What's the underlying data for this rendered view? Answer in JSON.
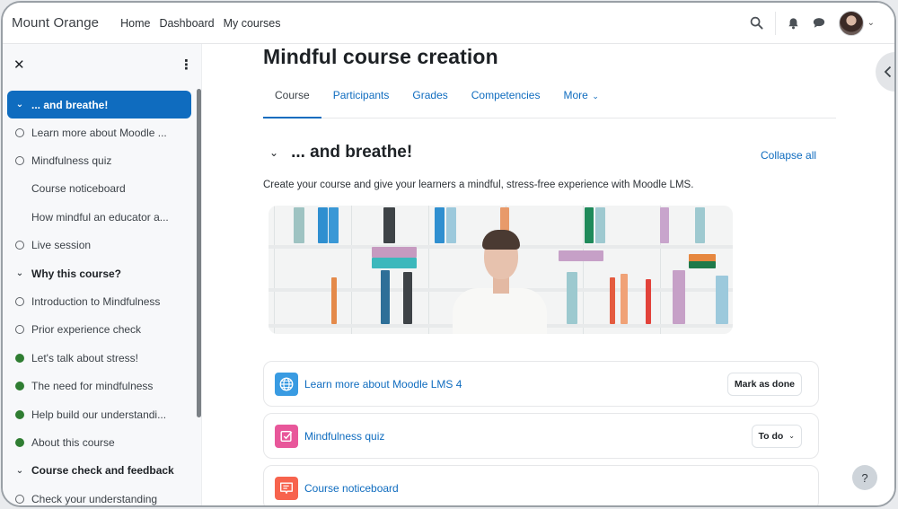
{
  "navbar": {
    "brand": "Mount Orange",
    "links": [
      "Home",
      "Dashboard",
      "My courses"
    ],
    "icons": [
      "search-icon",
      "bell-icon",
      "chat-icon"
    ],
    "user_menu_caret": "⌄"
  },
  "drawer": {
    "close_icon": "✕",
    "menu_icon": "⋮",
    "items": [
      {
        "label": "... and breathe!",
        "type": "section",
        "active": true
      },
      {
        "label": "Learn more about Moodle ...",
        "type": "activity",
        "status": "open"
      },
      {
        "label": "Mindfulness quiz",
        "type": "activity",
        "status": "open"
      },
      {
        "label": "Course noticeboard",
        "type": "activity",
        "status": "none"
      },
      {
        "label": "How mindful an educator a...",
        "type": "activity",
        "status": "none"
      },
      {
        "label": "Live session",
        "type": "activity",
        "status": "open"
      },
      {
        "label": "Why this course?",
        "type": "section",
        "active": false
      },
      {
        "label": "Introduction to Mindfulness",
        "type": "activity",
        "status": "open"
      },
      {
        "label": "Prior experience check",
        "type": "activity",
        "status": "open"
      },
      {
        "label": "Let's talk about stress!",
        "type": "activity",
        "status": "done"
      },
      {
        "label": "The need for mindfulness",
        "type": "activity",
        "status": "done"
      },
      {
        "label": "Help build our understandi...",
        "type": "activity",
        "status": "done"
      },
      {
        "label": "About this course",
        "type": "activity",
        "status": "done"
      },
      {
        "label": "Course check and feedback",
        "type": "section",
        "active": false
      },
      {
        "label": "Check your understanding",
        "type": "activity",
        "status": "open"
      }
    ]
  },
  "main": {
    "title": "Mindful course creation",
    "tabs": [
      {
        "label": "Course",
        "active": true
      },
      {
        "label": "Participants",
        "active": false
      },
      {
        "label": "Grades",
        "active": false
      },
      {
        "label": "Competencies",
        "active": false
      },
      {
        "label": "More",
        "active": false
      }
    ],
    "section": {
      "title": "... and breathe!",
      "collapse_all": "Collapse all",
      "summary": "Create your course and give your learners a mindful, stress-free experience with Moodle LMS."
    },
    "activities": [
      {
        "name": "Learn more about Moodle LMS 4",
        "icon": "globe-icon",
        "icon_color": "#399be2",
        "button": "Mark as done"
      },
      {
        "name": "Mindfulness quiz",
        "icon": "quiz-icon",
        "icon_color": "#e8579a",
        "button": "To do"
      },
      {
        "name": "Course noticeboard",
        "icon": "forum-icon",
        "icon_color": "#f7634d",
        "button": ""
      }
    ]
  },
  "help_label": "?",
  "colors": {
    "primary": "#0f6cbf",
    "completed": "#2f7d32"
  }
}
